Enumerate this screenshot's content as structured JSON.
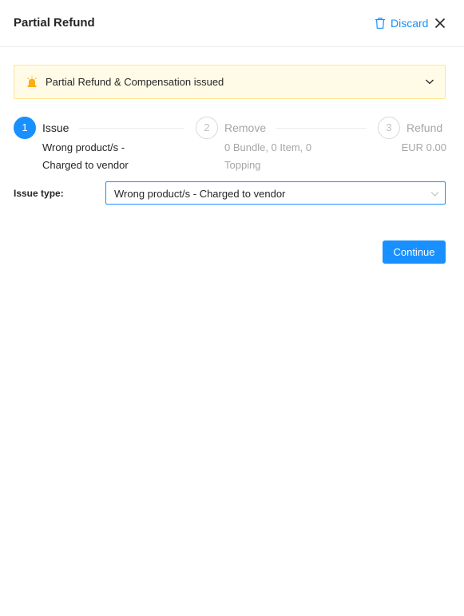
{
  "header": {
    "title": "Partial Refund",
    "discard_label": "Discard",
    "discard_icon": "trash-icon",
    "close_icon": "close-icon"
  },
  "alert": {
    "icon": "alarm-icon",
    "text": "Partial Refund & Compensation issued",
    "expand_icon": "chevron-down-icon"
  },
  "steps": [
    {
      "number": "1",
      "title": "Issue",
      "description": "Wrong product/s - Charged to vendor",
      "status": "active"
    },
    {
      "number": "2",
      "title": "Remove",
      "description": "0 Bundle, 0 Item, 0 Topping",
      "status": "wait"
    },
    {
      "number": "3",
      "title": "Refund",
      "description": "EUR 0.00",
      "status": "wait"
    }
  ],
  "form": {
    "issue_type_label": "Issue type:",
    "issue_type_value": "Wrong product/s - Charged to vendor"
  },
  "actions": {
    "continue_label": "Continue"
  },
  "colors": {
    "primary": "#1890ff",
    "alert_bg": "#fffbe6",
    "alert_border": "#ffe58f",
    "alert_icon": "#faad14"
  }
}
